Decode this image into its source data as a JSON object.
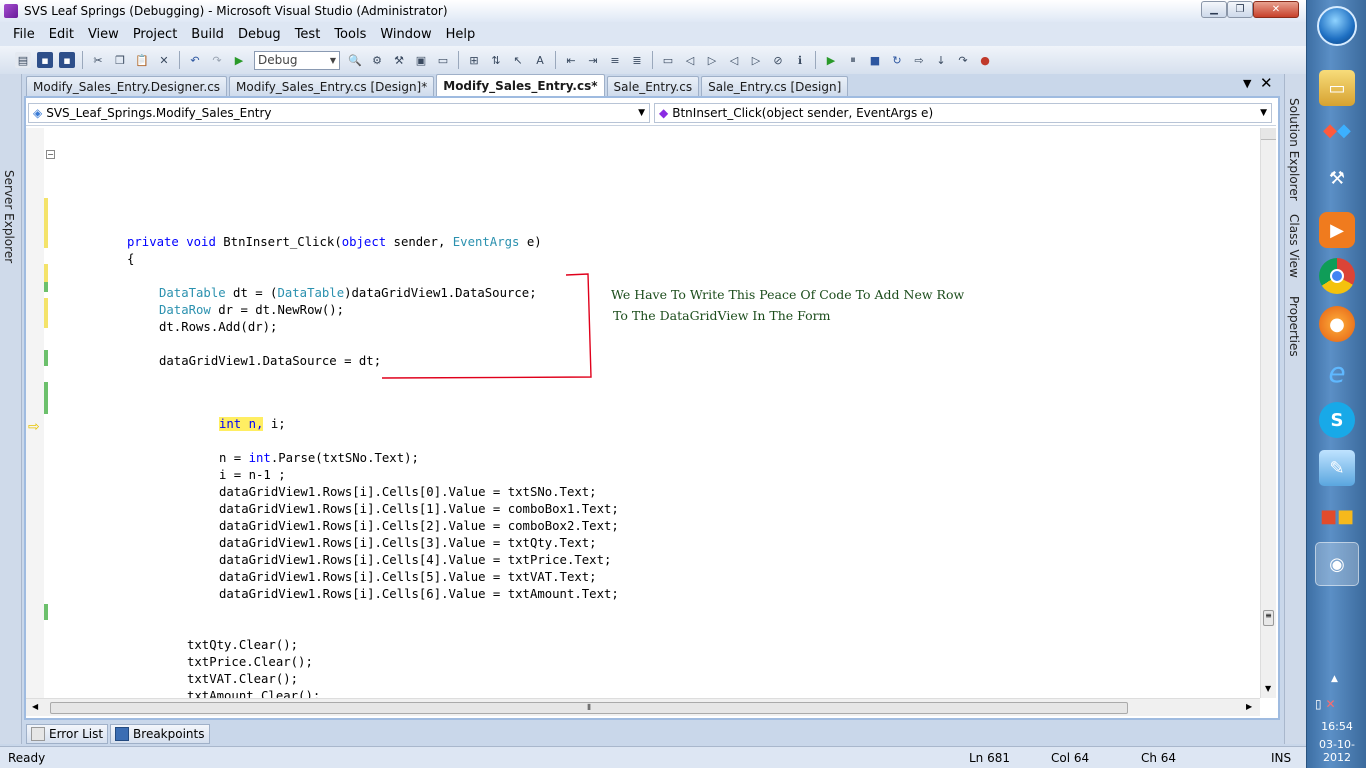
{
  "window": {
    "title": "SVS Leaf Springs (Debugging) - Microsoft Visual Studio (Administrator)"
  },
  "menu": [
    "File",
    "Edit",
    "View",
    "Project",
    "Build",
    "Debug",
    "Test",
    "Tools",
    "Window",
    "Help"
  ],
  "toolbar": {
    "config": "Debug"
  },
  "tabs": [
    {
      "label": "Modify_Sales_Entry.Designer.cs",
      "active": false
    },
    {
      "label": "Modify_Sales_Entry.cs [Design]*",
      "active": false
    },
    {
      "label": "Modify_Sales_Entry.cs*",
      "active": true
    },
    {
      "label": "Sale_Entry.cs",
      "active": false
    },
    {
      "label": "Sale_Entry.cs [Design]",
      "active": false
    }
  ],
  "sidepanels": {
    "left": "Server Explorer",
    "right": [
      "Solution Explorer",
      "Class View",
      "Properties"
    ]
  },
  "nav": {
    "class": "SVS_Leaf_Springs.Modify_Sales_Entry",
    "member": "BtnInsert_Click(object sender, EventArgs e)"
  },
  "code": {
    "l1": {
      "kw1": "private",
      "kw2": "void",
      "name": " BtnInsert_Click(",
      "kw3": "object",
      "mid": " sender, ",
      "ty": "EventArgs",
      "end": " e)"
    },
    "l2": "{",
    "l3": {
      "ty1": "DataTable",
      "a": " dt = (",
      "ty2": "DataTable",
      "b": ")dataGridView1.DataSource;"
    },
    "l4": {
      "ty": "DataRow",
      "rest": " dr = dt.NewRow();"
    },
    "l5": "dt.Rows.Add(dr);",
    "l6": "dataGridView1.DataSource = dt;",
    "l7": {
      "hl": "int n,",
      "rest": " i;"
    },
    "l8": {
      "a": "n = ",
      "kw": "int",
      "b": ".Parse(txtSNo.Text);"
    },
    "l9": "i = n-1 ;",
    "l10": "dataGridView1.Rows[i].Cells[0].Value = txtSNo.Text;",
    "l11": "dataGridView1.Rows[i].Cells[1].Value = comboBox1.Text;",
    "l12": "dataGridView1.Rows[i].Cells[2].Value = comboBox2.Text;",
    "l13": "dataGridView1.Rows[i].Cells[3].Value = txtQty.Text;",
    "l14": "dataGridView1.Rows[i].Cells[4].Value = txtPrice.Text;",
    "l15": "dataGridView1.Rows[i].Cells[5].Value = txtVAT.Text;",
    "l16": "dataGridView1.Rows[i].Cells[6].Value = txtAmount.Text;",
    "l17": "txtQty.Clear();",
    "l18": "txtPrice.Clear();",
    "l19": "txtVAT.Clear();",
    "l20": "txtAmount.Clear();"
  },
  "annotation": {
    "line1": "We Have To Write This Peace Of Code To Add New Row",
    "line2": "To The DataGridView In The Form",
    "color": "#e0001b"
  },
  "bottomTabs": [
    "Error List",
    "Breakpoints"
  ],
  "status": {
    "ready": "Ready",
    "ln": "Ln 681",
    "col": "Col 64",
    "ch": "Ch 64",
    "ins": "INS"
  },
  "tray": {
    "time": "16:54",
    "date": "03-10-2012"
  },
  "colors": {
    "keyword": "#0000ff",
    "type": "#2b91af",
    "highlight": "#ffee62"
  }
}
